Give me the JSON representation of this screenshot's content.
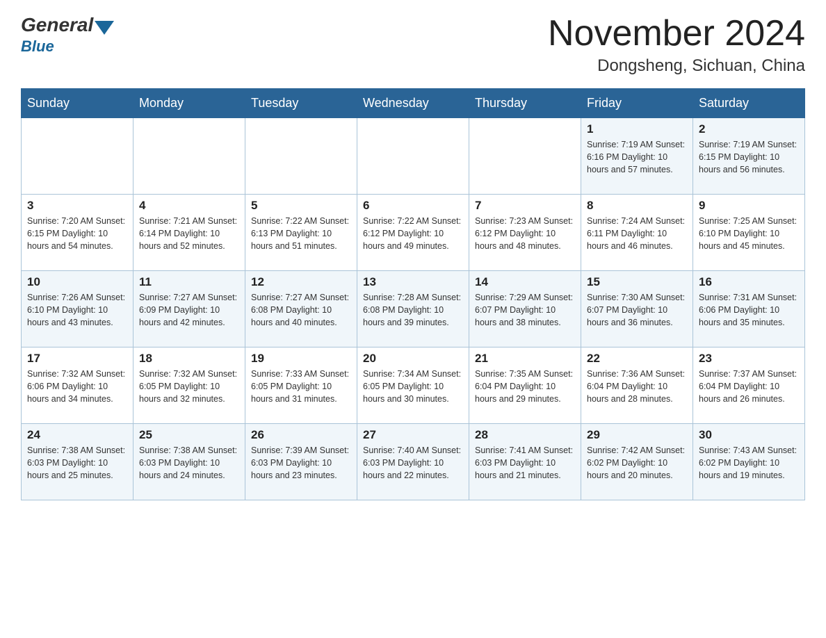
{
  "header": {
    "logo_general": "General",
    "logo_blue": "Blue",
    "title": "November 2024",
    "location": "Dongsheng, Sichuan, China"
  },
  "weekdays": [
    "Sunday",
    "Monday",
    "Tuesday",
    "Wednesday",
    "Thursday",
    "Friday",
    "Saturday"
  ],
  "rows": [
    {
      "days": [
        {
          "num": "",
          "detail": ""
        },
        {
          "num": "",
          "detail": ""
        },
        {
          "num": "",
          "detail": ""
        },
        {
          "num": "",
          "detail": ""
        },
        {
          "num": "",
          "detail": ""
        },
        {
          "num": "1",
          "detail": "Sunrise: 7:19 AM\nSunset: 6:16 PM\nDaylight: 10 hours\nand 57 minutes."
        },
        {
          "num": "2",
          "detail": "Sunrise: 7:19 AM\nSunset: 6:15 PM\nDaylight: 10 hours\nand 56 minutes."
        }
      ]
    },
    {
      "days": [
        {
          "num": "3",
          "detail": "Sunrise: 7:20 AM\nSunset: 6:15 PM\nDaylight: 10 hours\nand 54 minutes."
        },
        {
          "num": "4",
          "detail": "Sunrise: 7:21 AM\nSunset: 6:14 PM\nDaylight: 10 hours\nand 52 minutes."
        },
        {
          "num": "5",
          "detail": "Sunrise: 7:22 AM\nSunset: 6:13 PM\nDaylight: 10 hours\nand 51 minutes."
        },
        {
          "num": "6",
          "detail": "Sunrise: 7:22 AM\nSunset: 6:12 PM\nDaylight: 10 hours\nand 49 minutes."
        },
        {
          "num": "7",
          "detail": "Sunrise: 7:23 AM\nSunset: 6:12 PM\nDaylight: 10 hours\nand 48 minutes."
        },
        {
          "num": "8",
          "detail": "Sunrise: 7:24 AM\nSunset: 6:11 PM\nDaylight: 10 hours\nand 46 minutes."
        },
        {
          "num": "9",
          "detail": "Sunrise: 7:25 AM\nSunset: 6:10 PM\nDaylight: 10 hours\nand 45 minutes."
        }
      ]
    },
    {
      "days": [
        {
          "num": "10",
          "detail": "Sunrise: 7:26 AM\nSunset: 6:10 PM\nDaylight: 10 hours\nand 43 minutes."
        },
        {
          "num": "11",
          "detail": "Sunrise: 7:27 AM\nSunset: 6:09 PM\nDaylight: 10 hours\nand 42 minutes."
        },
        {
          "num": "12",
          "detail": "Sunrise: 7:27 AM\nSunset: 6:08 PM\nDaylight: 10 hours\nand 40 minutes."
        },
        {
          "num": "13",
          "detail": "Sunrise: 7:28 AM\nSunset: 6:08 PM\nDaylight: 10 hours\nand 39 minutes."
        },
        {
          "num": "14",
          "detail": "Sunrise: 7:29 AM\nSunset: 6:07 PM\nDaylight: 10 hours\nand 38 minutes."
        },
        {
          "num": "15",
          "detail": "Sunrise: 7:30 AM\nSunset: 6:07 PM\nDaylight: 10 hours\nand 36 minutes."
        },
        {
          "num": "16",
          "detail": "Sunrise: 7:31 AM\nSunset: 6:06 PM\nDaylight: 10 hours\nand 35 minutes."
        }
      ]
    },
    {
      "days": [
        {
          "num": "17",
          "detail": "Sunrise: 7:32 AM\nSunset: 6:06 PM\nDaylight: 10 hours\nand 34 minutes."
        },
        {
          "num": "18",
          "detail": "Sunrise: 7:32 AM\nSunset: 6:05 PM\nDaylight: 10 hours\nand 32 minutes."
        },
        {
          "num": "19",
          "detail": "Sunrise: 7:33 AM\nSunset: 6:05 PM\nDaylight: 10 hours\nand 31 minutes."
        },
        {
          "num": "20",
          "detail": "Sunrise: 7:34 AM\nSunset: 6:05 PM\nDaylight: 10 hours\nand 30 minutes."
        },
        {
          "num": "21",
          "detail": "Sunrise: 7:35 AM\nSunset: 6:04 PM\nDaylight: 10 hours\nand 29 minutes."
        },
        {
          "num": "22",
          "detail": "Sunrise: 7:36 AM\nSunset: 6:04 PM\nDaylight: 10 hours\nand 28 minutes."
        },
        {
          "num": "23",
          "detail": "Sunrise: 7:37 AM\nSunset: 6:04 PM\nDaylight: 10 hours\nand 26 minutes."
        }
      ]
    },
    {
      "days": [
        {
          "num": "24",
          "detail": "Sunrise: 7:38 AM\nSunset: 6:03 PM\nDaylight: 10 hours\nand 25 minutes."
        },
        {
          "num": "25",
          "detail": "Sunrise: 7:38 AM\nSunset: 6:03 PM\nDaylight: 10 hours\nand 24 minutes."
        },
        {
          "num": "26",
          "detail": "Sunrise: 7:39 AM\nSunset: 6:03 PM\nDaylight: 10 hours\nand 23 minutes."
        },
        {
          "num": "27",
          "detail": "Sunrise: 7:40 AM\nSunset: 6:03 PM\nDaylight: 10 hours\nand 22 minutes."
        },
        {
          "num": "28",
          "detail": "Sunrise: 7:41 AM\nSunset: 6:03 PM\nDaylight: 10 hours\nand 21 minutes."
        },
        {
          "num": "29",
          "detail": "Sunrise: 7:42 AM\nSunset: 6:02 PM\nDaylight: 10 hours\nand 20 minutes."
        },
        {
          "num": "30",
          "detail": "Sunrise: 7:43 AM\nSunset: 6:02 PM\nDaylight: 10 hours\nand 19 minutes."
        }
      ]
    }
  ]
}
